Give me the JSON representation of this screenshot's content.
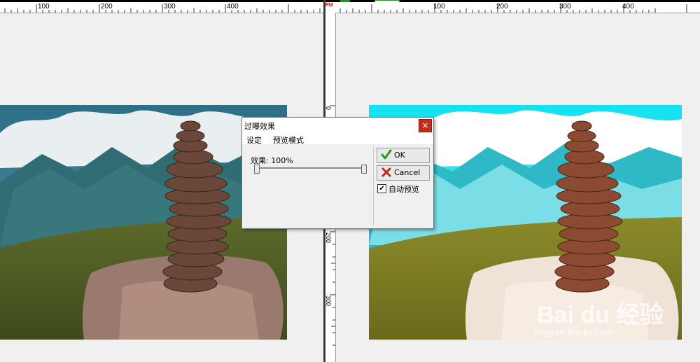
{
  "left_ruler": {
    "ticks": [
      "100",
      "200",
      "300",
      "400"
    ]
  },
  "right_ruler": {
    "ticks": [
      "100",
      "200",
      "300",
      "400"
    ]
  },
  "vertical_ruler": {
    "corner": "PIX",
    "ticks": [
      "0",
      "100",
      "200",
      "300"
    ]
  },
  "dialog": {
    "title": "过曝效果",
    "close_label": "×",
    "menu": [
      "设定",
      "预览模式"
    ],
    "effect_label": "效果: 100%",
    "effect_value_percent": 100,
    "ok_label": "OK",
    "cancel_label": "Cancel",
    "auto_preview_label": "自动预览",
    "auto_preview_checked": true
  },
  "watermark": {
    "brand": "Bai du 经验",
    "url": "jingyan.baidu.com"
  },
  "colors": {
    "ok_check": "#1f9a1f",
    "cancel_x": "#c0281c",
    "close_button": "#c42b1c"
  }
}
